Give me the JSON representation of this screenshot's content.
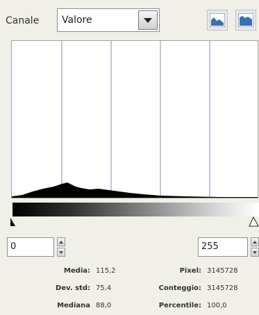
{
  "header": {
    "channel_label": "Canale",
    "channel_selected": "Valore"
  },
  "icons": {
    "linear_histogram": "linear-histogram-icon",
    "log_histogram": "logarithmic-histogram-icon",
    "dropdown": "chevron-down-icon"
  },
  "range": {
    "low": "0",
    "high": "255"
  },
  "stats": {
    "mean_label": "Media:",
    "mean_value": "115,2",
    "stddev_label": "Dev. std:",
    "stddev_value": "75,4",
    "median_label": "Mediana",
    "median_value": "88,0",
    "pixels_label": "Pixel:",
    "pixels_value": "3145728",
    "count_label": "Conteggio:",
    "count_value": "3145728",
    "percentile_label": "Percentile:",
    "percentile_value": "100,0"
  },
  "colors": {
    "background": "#f0efe8",
    "histogram_fill": "#000000",
    "grid_line": "#aab3c8",
    "icon_blue": "#3a6fb0"
  }
}
